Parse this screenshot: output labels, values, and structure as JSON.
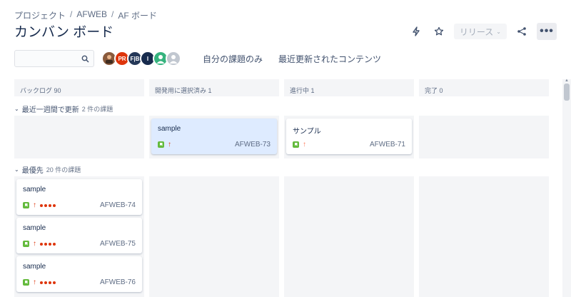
{
  "breadcrumb": [
    "プロジェクト",
    "AFWEB",
    "AF ボード"
  ],
  "title": "カンバン ボード",
  "header_actions": {
    "release_label": "リリース",
    "more_label": "•••"
  },
  "filters": {
    "search_placeholder": "",
    "avatars": [
      {
        "name": "photo",
        "color": "#8a5a3c",
        "initials": ""
      },
      {
        "name": "PR",
        "color": "#de350b",
        "initials": "PR"
      },
      {
        "name": "FB",
        "color": "#253858",
        "initials": "F|B"
      },
      {
        "name": "I",
        "color": "#172b4d",
        "initials": "I"
      },
      {
        "name": "user-green",
        "color": "#36b37e",
        "initials": ""
      },
      {
        "name": "user-grey",
        "color": "#c1c7d0",
        "initials": ""
      }
    ],
    "only_my_issues": "自分の課題のみ",
    "recently_updated": "最近更新されたコンテンツ"
  },
  "columns": [
    {
      "name": "バックログ",
      "count": "90"
    },
    {
      "name": "開発用に選択済み",
      "count": "1"
    },
    {
      "name": "進行中",
      "count": "1"
    },
    {
      "name": "完了",
      "count": "0"
    }
  ],
  "swimlanes": [
    {
      "label": "最近一週間で更新",
      "count": "2 件の課題"
    },
    {
      "label": "最優先",
      "count": "20 件の課題"
    }
  ],
  "cards": {
    "c73": {
      "title": "sample",
      "key": "AFWEB-73"
    },
    "c71": {
      "title": "サンプル",
      "key": "AFWEB-71"
    },
    "c74": {
      "title": "sample",
      "key": "AFWEB-74"
    },
    "c75": {
      "title": "sample",
      "key": "AFWEB-75"
    },
    "c76": {
      "title": "sample",
      "key": "AFWEB-76"
    }
  },
  "colors": {
    "highest": "#de350b",
    "high": "#ff7452",
    "story": "#63ba3c",
    "selected": "#deebff"
  }
}
